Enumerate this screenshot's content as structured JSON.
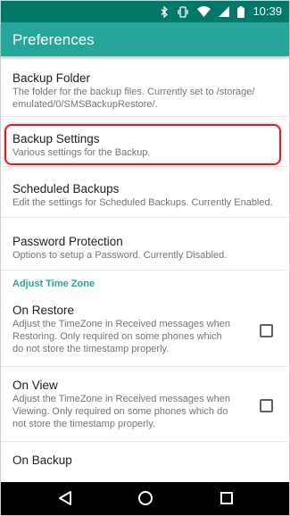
{
  "status_bar": {
    "time": "10:39",
    "icons": [
      "bluetooth-icon",
      "vibrate-icon",
      "wifi-icon",
      "signal-icon",
      "battery-icon"
    ]
  },
  "app_bar": {
    "title": "Preferences"
  },
  "preferences": [
    {
      "title": "Backup Folder",
      "summary": "The folder for the backup files. Currently set to /storage/ emulated/0/SMSBackupRestore/."
    },
    {
      "title": "Backup Settings",
      "summary": "Various settings for the Backup."
    },
    {
      "title": "Scheduled Backups",
      "summary": "Edit the settings for Scheduled Backups. Currently Enabled."
    },
    {
      "title": "Password Protection",
      "summary": "Options to setup a Password. Currently Disabled."
    }
  ],
  "time_zone": {
    "category": "Adjust Time Zone",
    "items": [
      {
        "title": "On Restore",
        "summary": "Adjust the TimeZone in Received messages when Restoring. Only required on some phones which do not store the timestamp properly.",
        "checked": false
      },
      {
        "title": "On View",
        "summary": "Adjust the TimeZone in Received messages when Viewing. Only required on some phones which do not store the timestamp properly.",
        "checked": false
      },
      {
        "title": "On Backup",
        "summary": "",
        "checked": false
      }
    ]
  },
  "nav_bar": {
    "icons": [
      "back-icon",
      "home-icon",
      "recents-icon"
    ]
  },
  "colors": {
    "status_bar": "#00796b",
    "app_bar": "#26a69a",
    "accent": "#26a69a",
    "highlight": "#d91e2a"
  }
}
